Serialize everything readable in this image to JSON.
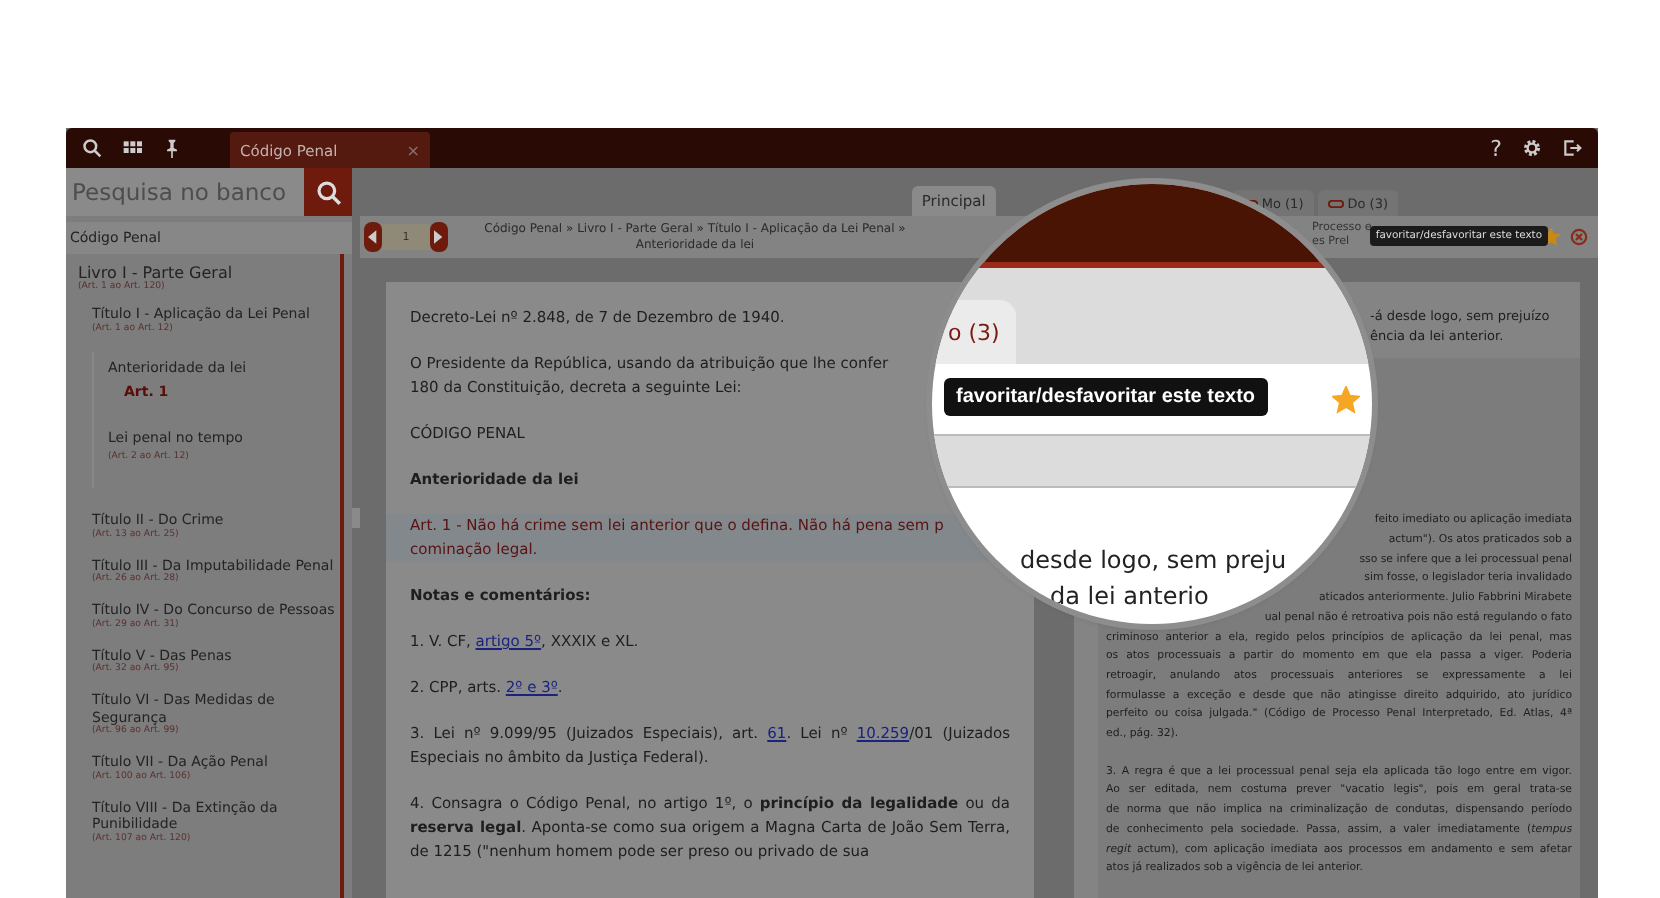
{
  "top_bar": {
    "tabs": [
      {
        "label": "Código Penal",
        "close": "×",
        "selected": true
      }
    ],
    "help": "?"
  },
  "sidebar": {
    "search": {
      "placeholder": "Pesquisa no banco"
    },
    "header": "Código Penal",
    "tree": [
      {
        "label": "Livro I - Parte Geral",
        "range": "(Art. 1 ao Art. 120)",
        "selected": false,
        "children": [
          {
            "label": "Título I - Aplicação da Lei Penal",
            "range": "(Art. 1 ao Art. 12)",
            "selected": false,
            "children": [
              {
                "label": "Anterioridade da lei",
                "selected": false,
                "children": [
                  {
                    "label": "Art. 1",
                    "selected": true
                  }
                ]
              },
              {
                "label": "Lei penal no tempo",
                "range": "(Art. 2 ao Art. 12)",
                "selected": false
              }
            ]
          },
          {
            "label": "Título II - Do Crime",
            "range": "(Art. 13 ao Art. 25)",
            "selected": false
          },
          {
            "label": "Título III - Da Imputabilidade Penal",
            "range": "(Art. 26 ao Art. 28)",
            "selected": false
          },
          {
            "label": "Título IV - Do Concurso de Pessoas",
            "range": "(Art. 29 ao Art. 31)",
            "selected": false
          },
          {
            "label": "Título V - Das Penas",
            "range": "(Art. 32 ao Art. 95)",
            "selected": false
          },
          {
            "label": "Título VI - Das Medidas de Segurança",
            "range": "(Art. 96 ao Art. 99)",
            "selected": false
          },
          {
            "label": "Título VII - Da Ação Penal",
            "range": "(Art. 100 ao Art. 106)",
            "selected": false
          },
          {
            "label": "Título VIII - Da Extinção da Punibilidade",
            "range": "(Art. 107 ao Art. 120)",
            "selected": false
          }
        ]
      }
    ]
  },
  "content_tabs": [
    {
      "label": "Principal",
      "selected": true,
      "linked": false
    },
    {
      "label": "Mo (1)",
      "selected": false,
      "linked": true
    },
    {
      "label": "Do (3)",
      "selected": false,
      "linked": true
    }
  ],
  "breadcrumb": {
    "page": "1",
    "path_lines": [
      "Código Penal » Livro I - Parte Geral » Título I - Aplicação da Lei Penal »",
      "Anterioridade da lei"
    ],
    "right_lines": [
      "Processo e",
      "es Prel"
    ]
  },
  "tooltip": "favoritar/desfavoritar este texto",
  "favorite": {
    "on": true
  },
  "document": [
    {
      "kind": "text",
      "lines": [
        "Decreto-Lei nº 2.848, de 7 de Dezembro de 1940."
      ]
    },
    {
      "kind": "text",
      "lines": [
        "O Presidente da República, usando da atribuição que lhe confer",
        "180 da Constituição, decreta a seguinte Lei:"
      ]
    },
    {
      "kind": "text",
      "lines": [
        "CÓDIGO PENAL"
      ]
    },
    {
      "kind": "heading",
      "lines": [
        "Anterioridade da lei"
      ]
    },
    {
      "kind": "article",
      "lines": [
        "Art. 1 - Não há crime sem lei anterior que o defina. Não há pena sem p",
        "cominação legal."
      ]
    },
    {
      "kind": "heading",
      "lines": [
        "Notas e comentários:"
      ]
    },
    {
      "kind": "note",
      "parts": [
        {
          "text": "1. V. CF, ",
          "link": false
        },
        {
          "text": "artigo 5º",
          "link": true
        },
        {
          "text": ", XXXIX e XL.",
          "link": false
        }
      ]
    },
    {
      "kind": "note",
      "parts": [
        {
          "text": "2. CPP, arts. ",
          "link": false
        },
        {
          "text": "2º e 3º",
          "link": true
        },
        {
          "text": ".",
          "link": false
        }
      ]
    },
    {
      "kind": "note",
      "parts": [
        {
          "text": "3. Lei nº 9.099/95 (Juizados Especiais), art. ",
          "link": false
        },
        {
          "text": "61",
          "link": true
        },
        {
          "text": ". Lei nº ",
          "link": false
        },
        {
          "text": "10.259",
          "link": true
        },
        {
          "text": "/01 (Juizados Especiais no âmbito da Justiça Federal).",
          "link": false
        }
      ]
    },
    {
      "kind": "note",
      "parts": [
        {
          "text": "4. Consagra o Código Penal, no artigo 1º, o **princípio da legalidade** ou da **reserva legal**. Aponta-se como sua origem a Magna Carta de João Sem Terra, de 1215 (\"nenhum homem pode ser preso ou privado de sua",
          "link": false
        }
      ]
    }
  ],
  "side_document": {
    "top_lines": [
      "-á desde logo, sem prejuízo",
      "ência da lei anterior."
    ],
    "box_lines": [
      {
        "text": "feito imediato ou aplicação imediata",
        "kind": "fragment"
      },
      {
        "text": "actum\"). Os atos praticados sob a",
        "kind": "fragment"
      },
      {
        "text": "sso se infere que a lei processual penal",
        "kind": "fragment"
      },
      {
        "text": "sim fosse, o legislador teria invalidado",
        "kind": "fragment"
      },
      {
        "text": "aticados anteriormente. Julio Fabbrini Mirabete",
        "kind": "fragment"
      },
      {
        "text": "ual penal não é retroativa pois não está regulando o fato",
        "kind": "fragment"
      },
      {
        "text": "criminoso anterior a ela, regido pelos princípios de aplicação da lei penal, mas",
        "kind": "full"
      },
      {
        "text": "os atos processuais a partir do momento em que ela passa a viger. Poderia",
        "kind": "full"
      },
      {
        "text": "retroagir, anulando atos processuais anteriores se expressamente a lei",
        "kind": "full"
      },
      {
        "text": "formulasse a exceção e desde que não atingisse direito adquirido, ato jurídico",
        "kind": "full"
      },
      {
        "text": "perfeito ou coisa julgada.\" (Código de Processo Penal Interpretado, Ed. Atlas, 4ª",
        "kind": "full"
      },
      {
        "text": "ed., pág. 32).",
        "kind": "last"
      },
      {
        "text": "3. A regra é que a lei processual penal seja ela aplicada tão logo entre em vigor.",
        "kind": "full"
      },
      {
        "text": "Ao ser editada, nem costuma prever \"vacatio legis\", pois em geral trata-se",
        "kind": "full"
      },
      {
        "text": "de norma que não implica na criminalização de condutas, dispensando período",
        "kind": "full"
      },
      {
        "text": "de conhecimento pela sociedade. Passa, assim, a valer imediatamente (*tempus*",
        "kind": "full"
      },
      {
        "text": "*regit* actum), com aplicação imediata aos processos em andamento e sem afetar",
        "kind": "full"
      },
      {
        "text": "atos já realizados sob a vigência de lei anterior.",
        "kind": "last"
      }
    ]
  },
  "magnifier": {
    "tab_label": "o (3)",
    "tooltip": "favoritar/desfavoritar este texto",
    "favorite_on": true,
    "text_lines": [
      "desde logo, sem preju",
      "da lei anterio"
    ]
  }
}
